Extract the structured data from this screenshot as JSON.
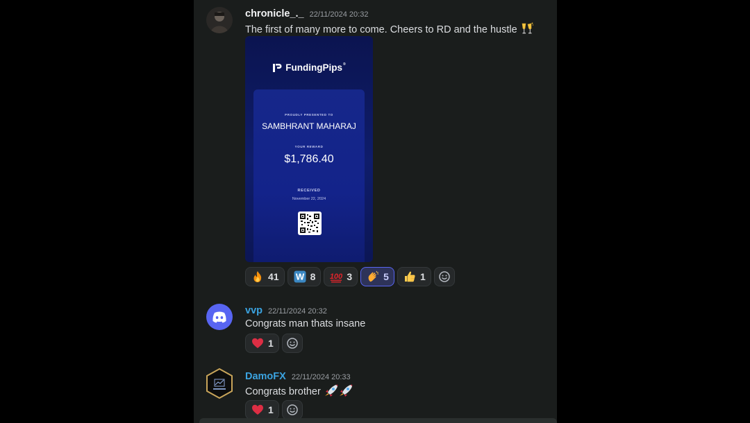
{
  "messages": [
    {
      "username": "chronicle_._",
      "username_color": "#f2f3f5",
      "timestamp": "22/11/2024 20:32",
      "text": "The first of many more to come. Cheers to RD and the hustle",
      "text_emoji": "clinking-glasses",
      "attachment": {
        "brand": "FundingPips",
        "presented_label": "PROUDLY PRESENTED TO",
        "recipient": "SAMBHRANT MAHARAJ",
        "reward_label": "YOUR REWARD",
        "amount": "$1,786.40",
        "received_label": "RECEIVED",
        "received_date": "November 22, 2024"
      },
      "reactions": [
        {
          "emoji": "fire",
          "count": "41",
          "active": false
        },
        {
          "emoji": "letter-w",
          "count": "8",
          "active": false
        },
        {
          "emoji": "hundred-points",
          "count": "3",
          "active": false
        },
        {
          "emoji": "clapping-hands",
          "count": "5",
          "active": true
        },
        {
          "emoji": "thumbs-up",
          "count": "1",
          "active": false
        }
      ]
    },
    {
      "username": "vvp",
      "username_color": "#3ba3e0",
      "timestamp": "22/11/2024 20:32",
      "text": "Congrats man thats insane",
      "reactions": [
        {
          "emoji": "red-heart",
          "count": "1",
          "active": false
        }
      ]
    },
    {
      "username": "DamoFX",
      "username_color": "#3ba3e0",
      "timestamp": "22/11/2024 20:33",
      "text": "Congrats brother",
      "text_emoji": "rocket-rocket",
      "reactions": [
        {
          "emoji": "red-heart",
          "count": "1",
          "active": false
        }
      ]
    }
  ],
  "colors": {
    "background": "#1a1d1c",
    "accent": "#5865f2",
    "timestamp": "#9a9ea3"
  }
}
